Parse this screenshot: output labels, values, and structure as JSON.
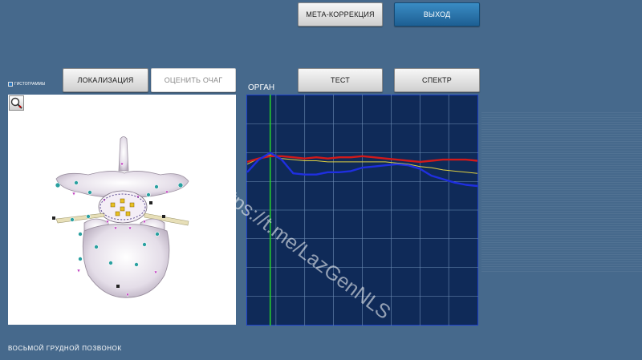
{
  "header": {
    "meta_correction_label": "МЕТА-КОРРЕКЦИЯ",
    "exit_label": "ВЫХОД"
  },
  "left_panel": {
    "histogram_label": "ГИСТОГРАММЫ",
    "localization_label": "ЛОКАЛИЗАЦИЯ",
    "evaluate_focus_label": "ОЦЕНИТЬ ОЧАГ",
    "organ_name": "ВОСЬМОЙ ГРУДНОЙ ПОЗВОНОК",
    "zoom_icon": "magnifier-icon"
  },
  "right_panel": {
    "organ_label": "ОРГАН",
    "test_label": "ТЕСТ",
    "spectrum_label": "СПЕКТР"
  },
  "watermark": "https://t.me/LazGenNLS",
  "chart_data": {
    "type": "line",
    "x": [
      0,
      4,
      8,
      12,
      16,
      20,
      24,
      28,
      32,
      36,
      40,
      44,
      48,
      52,
      56,
      60,
      64,
      68,
      72,
      76,
      80
    ],
    "grid": true,
    "cursor_x": 8,
    "series": [
      {
        "color": "#d21a1a",
        "values": [
          42,
          45,
          47,
          47,
          46,
          45,
          46,
          45,
          46,
          46,
          47,
          46,
          45,
          44,
          43,
          42,
          43,
          44,
          44,
          44,
          43
        ]
      },
      {
        "color": "#1f2fe0",
        "values": [
          33,
          44,
          50,
          44,
          32,
          31,
          31,
          33,
          33,
          34,
          37,
          38,
          39,
          40,
          39,
          36,
          30,
          27,
          24,
          22,
          21
        ]
      },
      {
        "color": "#e0d040",
        "values": [
          40,
          45,
          48,
          45,
          44,
          43,
          43,
          42,
          42,
          42,
          42,
          42,
          42,
          41,
          40,
          38,
          37,
          35,
          34,
          33,
          32
        ]
      }
    ],
    "ylim": [
      -100,
      100
    ],
    "xlim": [
      0,
      80
    ],
    "colors": {
      "background": "#0f2a58",
      "grid": "#6f8fb6",
      "cursor": "#28e028",
      "frame": "#1a3dc8"
    }
  }
}
